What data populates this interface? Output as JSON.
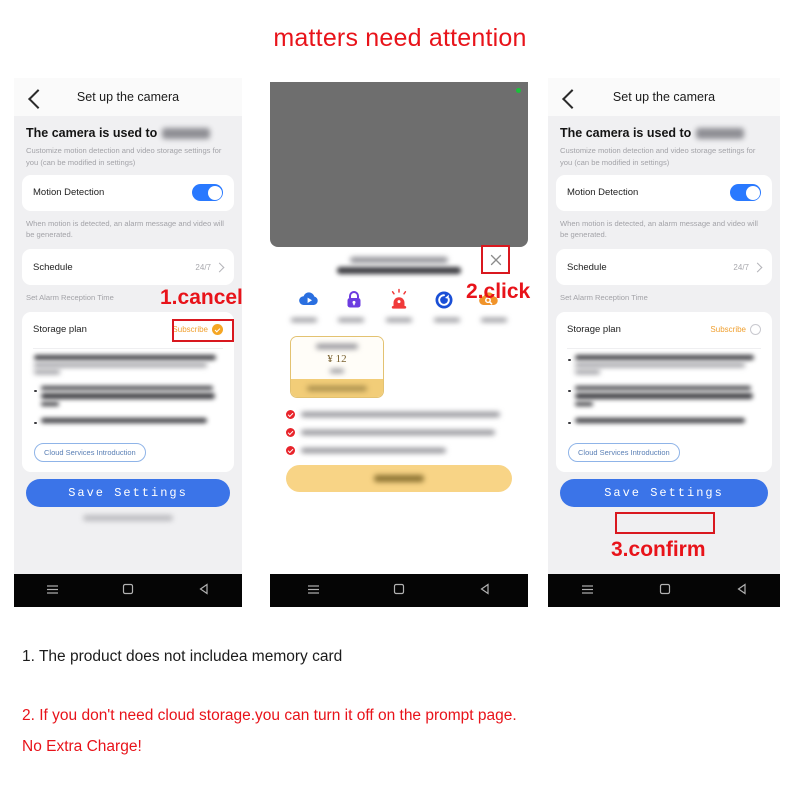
{
  "title": "matters need attention",
  "brand": {
    "red": "#e8131a",
    "blue": "#3b74e8",
    "gold": "#f2cd78",
    "orange": "#f0a030"
  },
  "app": {
    "appbar_title": "Set up the camera",
    "heading": "The camera is used to",
    "heading_note": "Customize motion detection and video storage settings for you (can be modified in settings)",
    "motion_label": "Motion Detection",
    "motion_note": "When motion is detected, an alarm message and video will be generated.",
    "schedule_label": "Schedule",
    "schedule_value": "24/7",
    "schedule_note": "Set Alarm Reception Time",
    "storage_label": "Storage plan",
    "subscribe_label": "Subscribe",
    "cloud_intro_label": "Cloud Services Introduction",
    "save_label": "Save Settings"
  },
  "middle": {
    "close_icon": "close-icon",
    "features": [
      {
        "name": "cloud-playback-icon",
        "color": "#2a6fe0"
      },
      {
        "name": "lock-icon",
        "color": "#6c3ce0"
      },
      {
        "name": "alarm-siren-icon",
        "color": "#f03a3a"
      },
      {
        "name": "cycle-record-icon",
        "color": "#1a4fd6"
      },
      {
        "name": "cloud-search-icon",
        "color": "#f0932a"
      }
    ],
    "price": "¥ 12"
  },
  "annotations": {
    "step1": "1.cancel",
    "step2": "2.click",
    "step3": "3.confirm"
  },
  "navbar": {
    "recents_icon": "menu-icon",
    "home_icon": "home-square-icon",
    "back_icon": "back-triangle-icon"
  },
  "captions": {
    "line1": "1. The product does not includea memory card",
    "line2": "2. If you don't need cloud storage.you can turn it off on the prompt page.",
    "line3": "No Extra Charge!"
  }
}
